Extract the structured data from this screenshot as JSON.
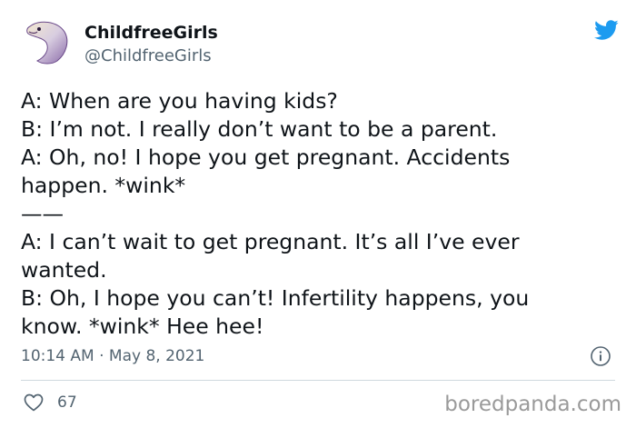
{
  "user": {
    "display_name": "ChildfreeGirls",
    "handle": "@ChildfreeGirls",
    "avatar_icon": "seal-avatar-icon"
  },
  "tweet": {
    "lines": [
      "A: When are you having kids?",
      "B: I’m not. I really don’t want to be a parent.",
      "A: Oh, no! I hope you get pregnant. Accidents",
      "happen. *wink*",
      "——",
      "A: I can’t wait to get pregnant. It’s all I’ve ever",
      "wanted.",
      "B: Oh, I hope you can’t! Infertility happens, you",
      "know. *wink* Hee hee!"
    ],
    "timestamp": "10:14 AM · May 8, 2021"
  },
  "engagement": {
    "likes": "67"
  },
  "watermark": "boredpanda.com",
  "icons": {
    "logo": "twitter-bird-icon",
    "info": "info-icon",
    "like": "heart-icon"
  },
  "colors": {
    "twitter_blue": "#1d9bf0",
    "text": "#0f1419",
    "secondary": "#536471",
    "divider": "#cfd9de",
    "watermark": "#9a9a9a"
  }
}
